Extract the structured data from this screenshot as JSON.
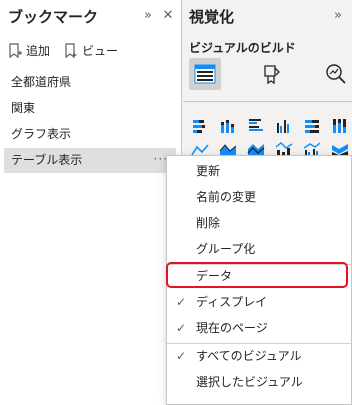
{
  "bookmarks": {
    "title": "ブックマーク",
    "add_label": "追加",
    "view_label": "ビュー",
    "items": [
      {
        "label": "全都道府県"
      },
      {
        "label": "関東"
      },
      {
        "label": "グラフ表示"
      },
      {
        "label": "テーブル表示"
      }
    ],
    "more": "···"
  },
  "visualizations": {
    "title": "視覚化",
    "subtitle": "ビジュアルのビルド",
    "accent": "#118dff",
    "tabs": [
      {
        "icon": "table-visual-icon",
        "active": true
      },
      {
        "icon": "format-paintbrush-icon",
        "active": false
      },
      {
        "icon": "analytics-magnifier-icon",
        "active": false
      }
    ],
    "gallery_icons": [
      "stacked-bar-icon",
      "stacked-column-icon",
      "clustered-bar-icon",
      "clustered-column-icon",
      "100-percent-bar-icon",
      "100-percent-column-icon",
      "line-chart-icon",
      "area-chart-icon",
      "stacked-area-icon",
      "line-column-icon",
      "line-clustered-column-icon",
      "ribbon-chart-icon"
    ]
  },
  "context_menu": {
    "items": [
      {
        "label": "更新",
        "checked": false
      },
      {
        "label": "名前の変更",
        "checked": false
      },
      {
        "label": "削除",
        "checked": false
      },
      {
        "label": "グループ化",
        "checked": false
      },
      {
        "label": "データ",
        "checked": false,
        "highlighted": true
      },
      {
        "label": "ディスプレイ",
        "checked": true
      },
      {
        "label": "現在のページ",
        "checked": true
      },
      {
        "label": "すべてのビジュアル",
        "checked": true
      },
      {
        "label": "選択したビジュアル",
        "checked": false
      }
    ],
    "check_glyph": "✓",
    "highlight_color": "#e81123"
  }
}
